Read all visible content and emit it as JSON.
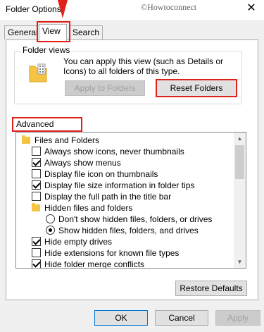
{
  "window": {
    "title": "Folder Options",
    "watermark": "©Howtoconnect",
    "close_glyph": "✕"
  },
  "tabs": [
    {
      "label": "General",
      "active": false
    },
    {
      "label": "View",
      "active": true
    },
    {
      "label": "Search",
      "active": false
    }
  ],
  "folder_views": {
    "title": "Folder views",
    "description": "You can apply this view (such as Details or Icons) to all folders of this type.",
    "apply_button": "Apply to Folders",
    "reset_button": "Reset Folders"
  },
  "advanced": {
    "label": "Advanced settings:",
    "items": [
      {
        "type": "folder",
        "label": "Files and Folders",
        "indent": 0
      },
      {
        "type": "checkbox",
        "label": "Always show icons, never thumbnails",
        "checked": false,
        "indent": 1
      },
      {
        "type": "checkbox",
        "label": "Always show menus",
        "checked": true,
        "indent": 1
      },
      {
        "type": "checkbox",
        "label": "Display file icon on thumbnails",
        "checked": false,
        "indent": 1
      },
      {
        "type": "checkbox",
        "label": "Display file size information in folder tips",
        "checked": true,
        "indent": 1
      },
      {
        "type": "checkbox",
        "label": "Display the full path in the title bar",
        "checked": false,
        "indent": 1
      },
      {
        "type": "folder",
        "label": "Hidden files and folders",
        "indent": 1
      },
      {
        "type": "radio",
        "label": "Don't show hidden files, folders, or drives",
        "checked": false,
        "indent": 2
      },
      {
        "type": "radio",
        "label": "Show hidden files, folders, and drives",
        "checked": true,
        "indent": 2
      },
      {
        "type": "checkbox",
        "label": "Hide empty drives",
        "checked": true,
        "indent": 1
      },
      {
        "type": "checkbox",
        "label": "Hide extensions for known file types",
        "checked": false,
        "indent": 1
      },
      {
        "type": "checkbox",
        "label": "Hide folder merge conflicts",
        "checked": true,
        "indent": 1
      }
    ],
    "scroll_up": "▲",
    "scroll_down": "▼"
  },
  "restore_button": "Restore Defaults",
  "footer": {
    "ok": "OK",
    "cancel": "Cancel",
    "apply": "Apply"
  },
  "colors": {
    "highlight": "#e0201b",
    "accent": "#0078d7",
    "folder": "#f4c442"
  }
}
